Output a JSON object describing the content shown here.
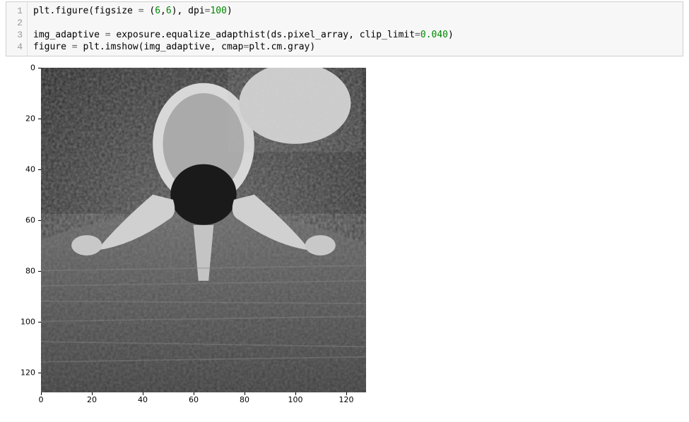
{
  "code": {
    "lines": [
      "plt.figure(figsize = (6,6), dpi=100)",
      "",
      "img_adaptive = exposure.equalize_adapthist(ds.pixel_array, clip_limit=0.040)",
      "figure = plt.imshow(img_adaptive, cmap=plt.cm.gray)"
    ],
    "line_numbers": [
      "1",
      "2",
      "3",
      "4"
    ],
    "tokens": {
      "figsize_a": "6",
      "figsize_b": "6",
      "dpi": "100",
      "clip_limit": "0.040"
    }
  },
  "chart_data": {
    "type": "image",
    "description": "Grayscale CT axial slice of the lumbar spine after adaptive histogram equalization (CLAHE). Vertebral body, spinal canal, transverse processes and surrounding soft tissue visible.",
    "colormap": "gray",
    "extent": {
      "xmin": 0,
      "xmax": 128,
      "ymin": 128,
      "ymax": 0
    },
    "shape": [
      128,
      128
    ],
    "x_ticks": [
      0,
      20,
      40,
      60,
      80,
      100,
      120
    ],
    "y_ticks": [
      0,
      20,
      40,
      60,
      80,
      100,
      120
    ],
    "pixel_origin": "upper-left",
    "title": "",
    "xlabel": "",
    "ylabel": ""
  }
}
